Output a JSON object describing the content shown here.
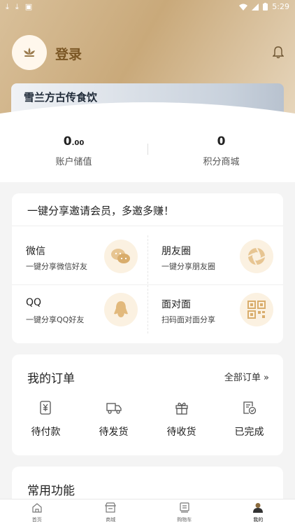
{
  "status_bar": {
    "time": "5:29"
  },
  "header": {
    "login_label": "登录",
    "banner_title": "雪兰方古传食饮"
  },
  "account": {
    "balance_int": "0",
    "balance_dec": ".00",
    "balance_label": "账户储值",
    "points_value": "0",
    "points_label": "积分商城"
  },
  "share": {
    "title": "一键分享邀请会员，多邀多赚！",
    "items": [
      {
        "name": "微信",
        "desc": "一键分享微信好友",
        "icon": "wechat-icon"
      },
      {
        "name": "朋友圈",
        "desc": "一键分享朋友圈",
        "icon": "moments-icon"
      },
      {
        "name": "QQ",
        "desc": "一键分享QQ好友",
        "icon": "qq-icon"
      },
      {
        "name": "面对面",
        "desc": "扫码面对面分享",
        "icon": "qr-code-icon"
      }
    ]
  },
  "orders": {
    "title": "我的订单",
    "all_label": "全部订单",
    "items": [
      {
        "label": "待付款",
        "icon": "payment-icon"
      },
      {
        "label": "待发货",
        "icon": "truck-icon"
      },
      {
        "label": "待收货",
        "icon": "gift-icon"
      },
      {
        "label": "已完成",
        "icon": "done-doc-icon"
      }
    ]
  },
  "functions": {
    "title": "常用功能"
  },
  "tabbar": [
    {
      "label": "首页",
      "icon": "home-icon"
    },
    {
      "label": "商城",
      "icon": "store-icon"
    },
    {
      "label": "购物车",
      "icon": "cart-icon"
    },
    {
      "label": "我的",
      "icon": "user-icon"
    }
  ],
  "colors": {
    "accent": "#c9a97a",
    "login": "#7a5624",
    "icon_bg": "#fbf1e1"
  }
}
